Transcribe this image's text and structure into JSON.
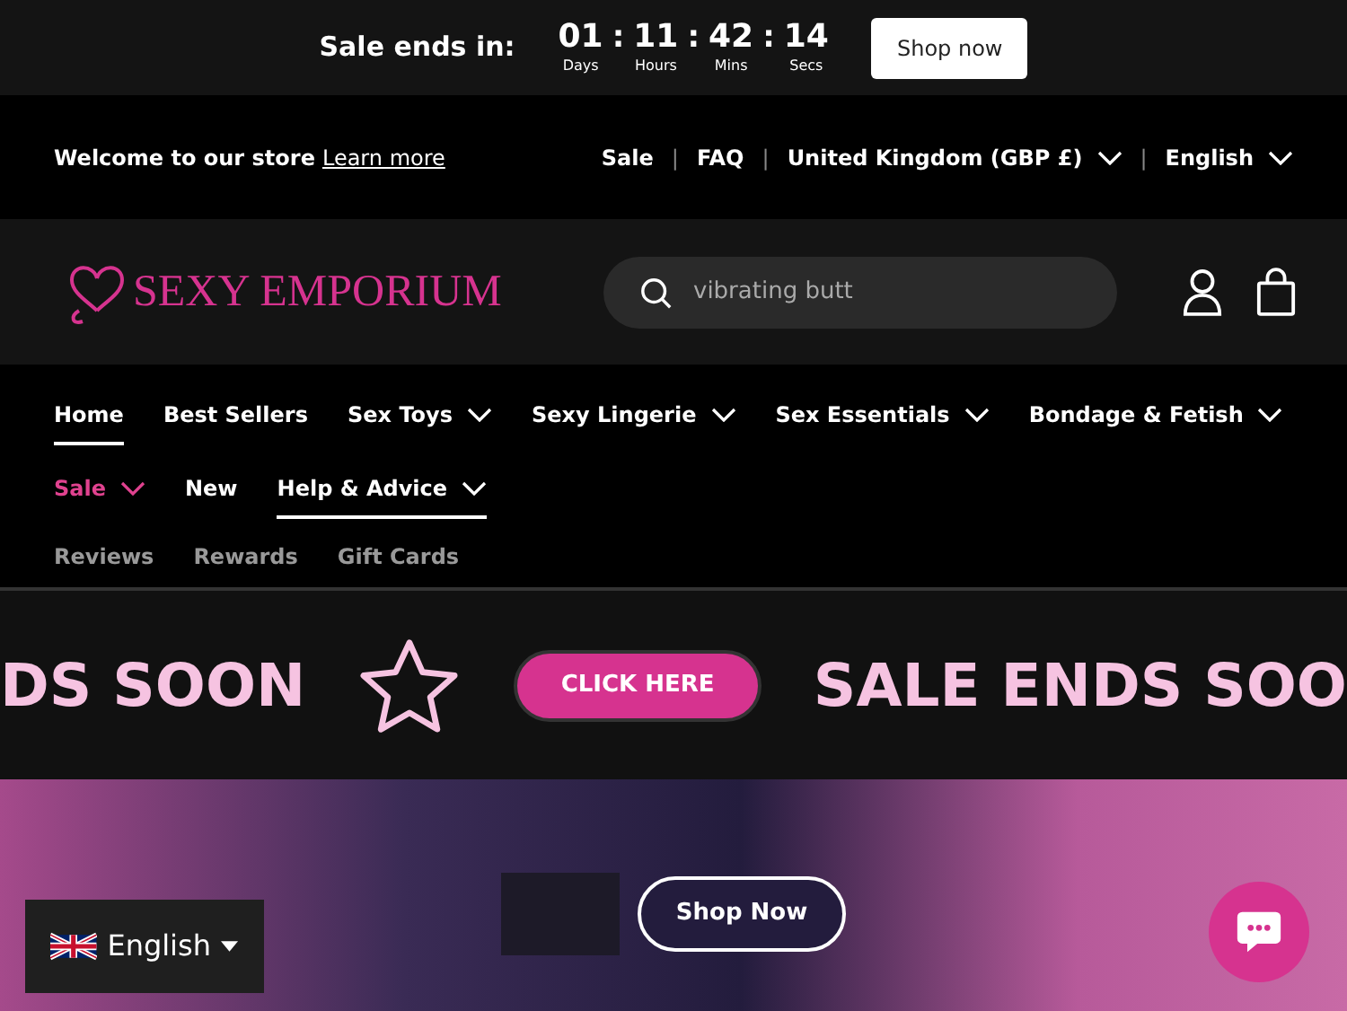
{
  "announcement": {
    "title": "Sale ends in:",
    "countdown": [
      {
        "value": "01",
        "label": "Days"
      },
      {
        "value": "11",
        "label": "Hours"
      },
      {
        "value": "42",
        "label": "Mins"
      },
      {
        "value": "14",
        "label": "Secs"
      }
    ],
    "separator": ":",
    "button": "Shop now"
  },
  "utility_bar": {
    "welcome": "Welcome to our store",
    "link": "Learn more",
    "links": [
      {
        "label": "Sale",
        "has_menu": false
      },
      {
        "label": "FAQ",
        "has_menu": false
      },
      {
        "label": "United Kingdom (GBP £)",
        "has_menu": true
      },
      {
        "label": "English",
        "has_menu": true
      }
    ],
    "divider": "|"
  },
  "header": {
    "logo": "SEXY EMPORIUM",
    "search": {
      "value": "vibrating butt"
    }
  },
  "nav": {
    "rows": [
      [
        {
          "label": "Home",
          "has_menu": false,
          "selected": true,
          "highlight": false
        },
        {
          "label": "Best Sellers",
          "has_menu": false,
          "selected": false,
          "highlight": false
        },
        {
          "label": "Sex Toys",
          "has_menu": true,
          "selected": false,
          "highlight": false
        },
        {
          "label": "Sexy Lingerie",
          "has_menu": true,
          "selected": false,
          "highlight": false
        },
        {
          "label": "Sex Essentials",
          "has_menu": true,
          "selected": false,
          "highlight": false
        },
        {
          "label": "Bondage & Fetish",
          "has_menu": true,
          "selected": false,
          "highlight": false
        }
      ],
      [
        {
          "label": "Sale",
          "has_menu": true,
          "selected": false,
          "highlight": true
        },
        {
          "label": "New",
          "has_menu": false,
          "selected": false,
          "highlight": false
        },
        {
          "label": "Help & Advice",
          "has_menu": true,
          "selected": true,
          "highlight": false
        }
      ]
    ],
    "secondary": [
      "Reviews",
      "Rewards",
      "Gift Cards"
    ]
  },
  "marquee": {
    "left_text": "DS SOON",
    "button": "CLICK HERE",
    "right_text": "SALE ENDS SOO"
  },
  "hero": {
    "button": "Shop Now"
  },
  "language_picker": {
    "label": "English"
  }
}
